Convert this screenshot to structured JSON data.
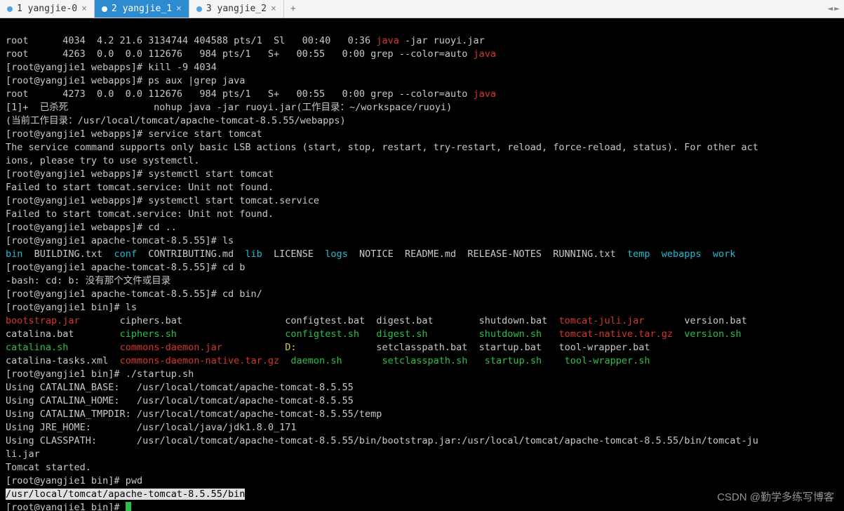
{
  "tabs": [
    {
      "label": "1 yangjie-0",
      "active": false
    },
    {
      "label": "2 yangjie_1",
      "active": true
    },
    {
      "label": "3 yangjie_2",
      "active": false
    }
  ],
  "tab_add_label": "+",
  "scroll": {
    "left": "◄",
    "right": "►"
  },
  "prompt": {
    "p1": "[root@yangjie1 webapps]# ",
    "p2": "[root@yangjie1 apache-tomcat-8.5.55]# ",
    "p3": "[root@yangjie1 bin]# "
  },
  "ps_line1": "root      4034  4.2 21.6 3134744 404588 pts/1  Sl   00:40   0:36 ",
  "ps_line1_java": "java",
  "ps_line1_tail": " -jar ruoyi.jar",
  "ps_line2": "root      4263  0.0  0.0 112676   984 pts/1   S+   00:55   0:00 grep --color=auto ",
  "ps_line2_java": "java",
  "cmd_kill": "kill -9 4034",
  "cmd_ps": "ps aux |grep java",
  "ps_line3": "root      4273  0.0  0.0 112676   984 pts/1   S+   00:55   0:00 grep --color=auto ",
  "ps_line3_java": "java",
  "nohup_line": "[1]+  已杀死               nohup java -jar ruoyi.jar(工作目录：~/workspace/ruoyi)",
  "nohup_cwd": "(当前工作目录：/usr/local/tomcat/apache-tomcat-8.5.55/webapps)",
  "cmd_service": "service start tomcat",
  "service_msg1": "The service command supports only basic LSB actions (start, stop, restart, try-restart, reload, force-reload, status). For other act",
  "service_msg2": "ions, please try to use systemctl.",
  "cmd_sys1": "systemctl start tomcat",
  "fail_msg": "Failed to start tomcat.service: Unit not found.",
  "cmd_sys2": "systemctl start tomcat.service",
  "cmd_cdup": "cd ..",
  "cmd_ls": "ls",
  "ls_tomcat_row": {
    "bin": "bin",
    "build": "  BUILDING.txt  ",
    "conf": "conf",
    "contrib": "  CONTRIBUTING.md  ",
    "lib": "lib",
    "license": "  LICENSE  ",
    "logs": "logs",
    "notice": "  NOTICE  README.md  RELEASE-NOTES  RUNNING.txt  ",
    "temp": "temp",
    "sp1": "  ",
    "webapps": "webapps",
    "sp2": "  ",
    "work": "work"
  },
  "cmd_cdb": "cd b",
  "bash_err": "-bash: cd: b: 没有那个文件或目录",
  "cmd_cdbin": "cd bin/",
  "bin_ls": {
    "r1": {
      "c1": "bootstrap.jar",
      "sp1": "       ",
      "c2": "ciphers.bat",
      "sp2": "                  ",
      "c3": "configtest.bat",
      "sp3": "  ",
      "c4": "digest.bat",
      "sp4": "        ",
      "c5": "shutdown.bat",
      "sp5": "  ",
      "c6": "tomcat-juli.jar",
      "sp6": "       ",
      "c7": "version.bat"
    },
    "r2": {
      "c1": "catalina.bat",
      "sp1": "        ",
      "c2": "ciphers.sh",
      "sp2": "                   ",
      "c3": "configtest.sh",
      "sp3": "   ",
      "c4": "digest.sh",
      "sp4": "         ",
      "c5": "shutdown.sh",
      "sp5": "   ",
      "c6": "tomcat-native.tar.gz",
      "sp6": "  ",
      "c7": "version.sh"
    },
    "r3": {
      "c1": "catalina.sh",
      "sp1": "         ",
      "c2": "commons-daemon.jar",
      "sp2": "           ",
      "c3": "D:",
      "sp3": "              ",
      "c4": "setclasspath.bat",
      "sp4": "  ",
      "c5": "startup.bat",
      "sp5": "   ",
      "c6": "tool-wrapper.bat",
      "sp6": ""
    },
    "r4": {
      "c1": "catalina-tasks.xml",
      "sp1": "  ",
      "c2": "commons-daemon-native.tar.gz",
      "sp2": "  ",
      "c3": "daemon.sh",
      "sp3": "       ",
      "c4": "setclasspath.sh",
      "sp4": "   ",
      "c5": "startup.sh",
      "sp5": "    ",
      "c6": "tool-wrapper.sh",
      "sp6": ""
    }
  },
  "cmd_startup": "./startup.sh",
  "env1": "Using CATALINA_BASE:   /usr/local/tomcat/apache-tomcat-8.5.55",
  "env2": "Using CATALINA_HOME:   /usr/local/tomcat/apache-tomcat-8.5.55",
  "env3": "Using CATALINA_TMPDIR: /usr/local/tomcat/apache-tomcat-8.5.55/temp",
  "env4": "Using JRE_HOME:        /usr/local/java/jdk1.8.0_171",
  "env5": "Using CLASSPATH:       /usr/local/tomcat/apache-tomcat-8.5.55/bin/bootstrap.jar:/usr/local/tomcat/apache-tomcat-8.5.55/bin/tomcat-ju",
  "env5b": "li.jar",
  "started": "Tomcat started.",
  "cmd_pwd": "pwd",
  "pwd_out": "/usr/local/tomcat/apache-tomcat-8.5.55/bin",
  "watermark": "CSDN @勤学多练写博客"
}
